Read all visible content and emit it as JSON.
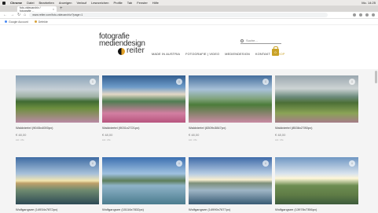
{
  "mac_menu": {
    "items": [
      "Chrome",
      "Datei",
      "Bearbeiten",
      "Anzeigen",
      "Verlauf",
      "Lesezeichen",
      "Profile",
      "Tab",
      "Fenster",
      "Hilfe"
    ],
    "status_right": "Mo. 14:25"
  },
  "browser": {
    "tab_title": "foto-videoarchiv / fotografie ...",
    "url": "www.reiter.com/foto-videoarchiv/?page=1",
    "bookmarks": [
      "Google Account",
      "Defekte"
    ]
  },
  "site": {
    "logo_line1": "fotografie",
    "logo_line2": "mediendesign",
    "logo_line3": "reiter",
    "search_placeholder": "Suche...",
    "menu": [
      "MADE IN AUSTRIA",
      "FOTOGRAFIE | VIDEO",
      "MEDIENDESIGN",
      "KONTAKT",
      "SHOP"
    ],
    "cart_count": "0"
  },
  "products": [
    {
      "title": "Waldviertel (9045x4000px)",
      "price": "€ 48,00",
      "tax": "inkl. USt."
    },
    {
      "title": "Waldviertel (9031x2721px)",
      "price": "€ 48,00",
      "tax": "inkl. USt."
    },
    {
      "title": "Waldviertel (8309x3847px)",
      "price": "€ 48,00",
      "tax": "inkl. USt."
    },
    {
      "title": "Waldviertel (8536x2780px)",
      "price": "€ 48,00",
      "tax": "inkl. USt."
    },
    {
      "title": "Wolfgangsee (14934x7872px)",
      "price": "",
      "tax": ""
    },
    {
      "title": "Wolfgangsee (15116x7832px)",
      "price": "",
      "tax": ""
    },
    {
      "title": "Wolfgangsee (14990x7677px)",
      "price": "",
      "tax": ""
    },
    {
      "title": "Wolfgangsee (13978x7356px)",
      "price": "",
      "tax": ""
    }
  ]
}
